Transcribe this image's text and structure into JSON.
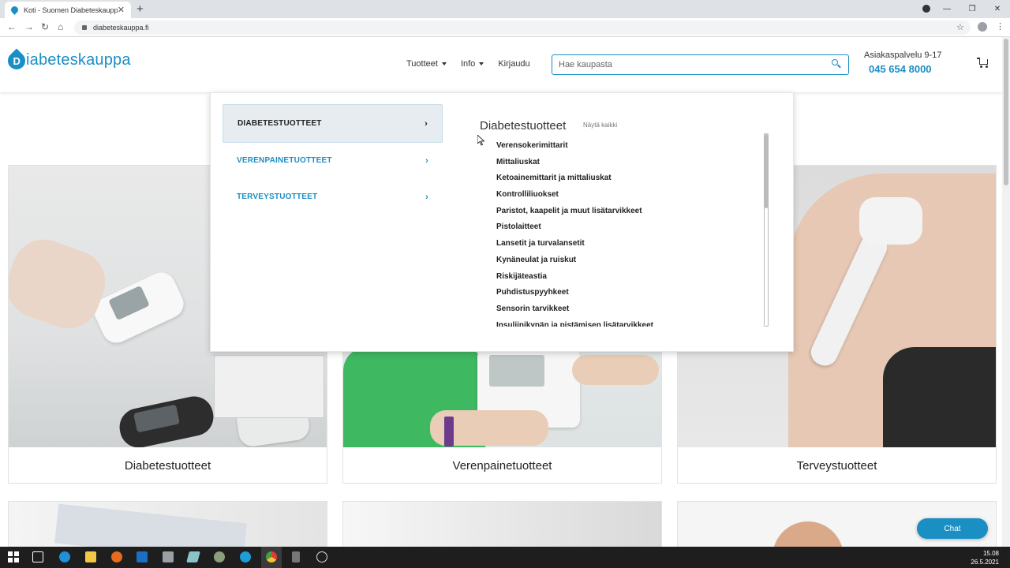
{
  "browser": {
    "tab_title": "Koti - Suomen Diabeteskauppa",
    "tab_close": "✕",
    "new_tab": "+",
    "url": "diabeteskauppa.fi",
    "back": "←",
    "forward": "→",
    "reload": "↻",
    "home": "⌂",
    "star": "☆",
    "menu": "⋮",
    "window_controls": [
      "—",
      "❐",
      "✕"
    ]
  },
  "header": {
    "logo_letter": "D",
    "logo_text": "iabeteskauppa",
    "nav": [
      {
        "label": "Tuotteet",
        "has_caret": true
      },
      {
        "label": "Info",
        "has_caret": true
      },
      {
        "label": "Kirjaudu",
        "has_caret": false
      }
    ],
    "search_placeholder": "Hae kaupasta",
    "service_label": "Asiakaspalvelu 9-17",
    "phone": "045 654 8000"
  },
  "mega_menu": {
    "categories": [
      {
        "label": "DIABETESTUOTTEET",
        "active": true
      },
      {
        "label": "VERENPAINETUOTTEET",
        "active": false
      },
      {
        "label": "TERVEYSTUOTTEET",
        "active": false
      }
    ],
    "chevron": "›",
    "sub_title": "Diabetestuotteet",
    "show_all": "Näytä kaikki",
    "sub_items": [
      "Verensokerimittarit",
      "Mittaliuskat",
      "Ketoainemittarit ja mittaliuskat",
      "Kontrolliliuokset",
      "Paristot, kaapelit ja muut lisätarvikkeet",
      "Pistolaitteet",
      "Lansetit ja turvalansetit",
      "Kynäneulat ja ruiskut",
      "Riskijäteastia",
      "Puhdistuspyyhkeet",
      "Sensorin tarvikkeet",
      "Insuliinikynän ja pistämisen lisätarvikkeet"
    ]
  },
  "cards": [
    {
      "label": "Diabetestuotteet"
    },
    {
      "label": "Verenpainetuotteet"
    },
    {
      "label": "Terveystuotteet"
    }
  ],
  "chat": {
    "label": "Chat"
  },
  "taskbar": {
    "time": "15.08",
    "date": "26.5.2021"
  },
  "colors": {
    "brand": "#1a8fc4",
    "active_bg": "#e6ecef"
  }
}
